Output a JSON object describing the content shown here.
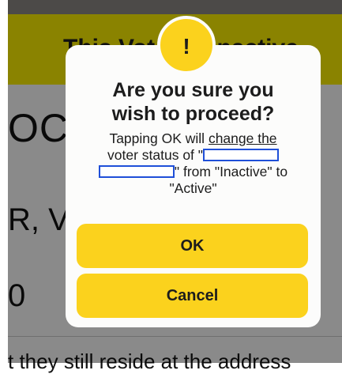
{
  "background": {
    "banner_text": "This Voter is Inactive",
    "name_partial": "OC",
    "party_partial": "R, V",
    "number_partial": "0",
    "bottom_partial": "t they still reside at the address"
  },
  "dialog": {
    "icon": "exclamation-icon",
    "icon_glyph": "!",
    "title_line1": "Are you sure you",
    "title_line2": "wish to proceed?",
    "message": {
      "line1_a": "Tapping OK will ",
      "line1_b": "change the",
      "line2": "voter status of \"",
      "line3_tail": "\" from \"Inactive\" to",
      "line4": "\"Active\""
    },
    "ok_label": "OK",
    "cancel_label": "Cancel"
  },
  "colors": {
    "banner": "#fff200",
    "button": "#fbd21d",
    "redaction_border": "#1f4fd8"
  }
}
